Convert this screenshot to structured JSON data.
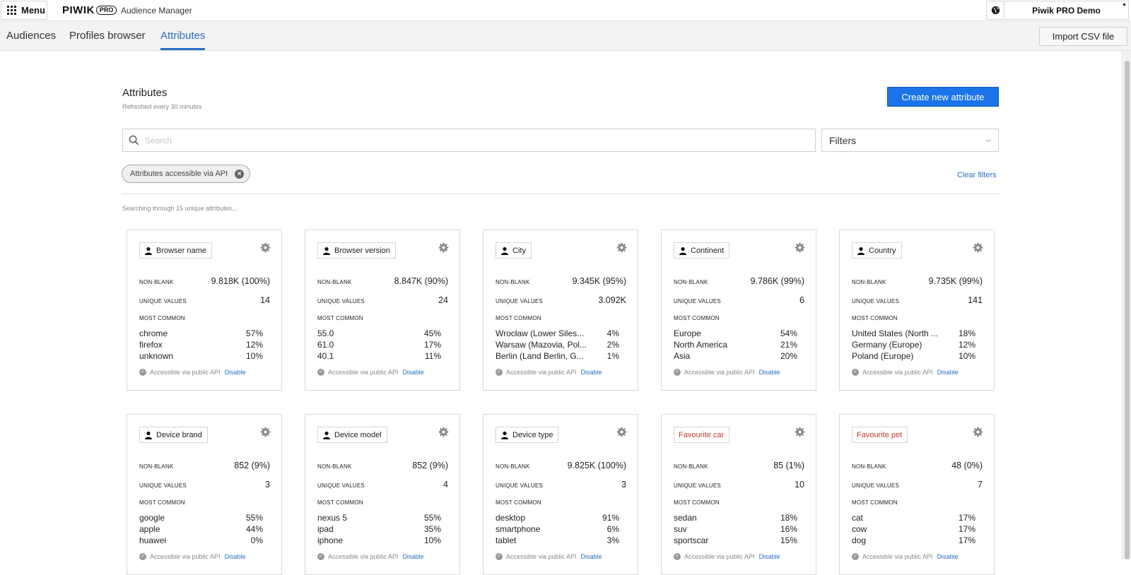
{
  "topbar": {
    "menu_label": "Menu",
    "logo_text": "PIWIK",
    "logo_badge": "PRO",
    "app_name": "Audience Manager",
    "account_name": "Piwik PRO Demo"
  },
  "nav": {
    "tabs": [
      {
        "label": "Audiences",
        "active": false
      },
      {
        "label": "Profiles browser",
        "active": false
      },
      {
        "label": "Attributes",
        "active": true
      }
    ],
    "import_label": "Import CSV file"
  },
  "header": {
    "title": "Attributes",
    "subtitle": "Refreshed every 30 minutes",
    "create_label": "Create new attribute"
  },
  "search": {
    "placeholder": "Search",
    "value": "",
    "filters_label": "Filters"
  },
  "active_filter": {
    "label": "Attributes accessible via API",
    "clear_label": "Clear filters"
  },
  "search_status": "Searching through 15 unique attributes...",
  "labels": {
    "non_blank": "NON-BLANK",
    "unique_values": "UNIQUE VALUES",
    "most_common": "MOST COMMON",
    "api_text": "Accessible via public API",
    "disable": "Disable"
  },
  "colors": {
    "accent": "#1a73e8",
    "link": "#2a6fc4",
    "custom_attribute": "#c0392b"
  },
  "cards": [
    {
      "name": "Browser name",
      "custom": false,
      "non_blank": "9.818K (100%)",
      "unique": "14",
      "common": [
        {
          "n": "chrome",
          "p": "57%"
        },
        {
          "n": "firefox",
          "p": "12%"
        },
        {
          "n": "unknown",
          "p": "10%"
        }
      ]
    },
    {
      "name": "Browser version",
      "custom": false,
      "non_blank": "8.847K (90%)",
      "unique": "24",
      "common": [
        {
          "n": "55.0",
          "p": "45%"
        },
        {
          "n": "61.0",
          "p": "17%"
        },
        {
          "n": "40.1",
          "p": "11%"
        }
      ]
    },
    {
      "name": "City",
      "custom": false,
      "non_blank": "9.345K (95%)",
      "unique": "3.092K",
      "common": [
        {
          "n": "Wrocław (Lower Siles...",
          "p": "4%"
        },
        {
          "n": "Warsaw (Mazovia, Pol...",
          "p": "2%"
        },
        {
          "n": "Berlin (Land Berlin, G...",
          "p": "1%"
        }
      ]
    },
    {
      "name": "Continent",
      "custom": false,
      "non_blank": "9.786K (99%)",
      "unique": "6",
      "common": [
        {
          "n": "Europe",
          "p": "54%"
        },
        {
          "n": "North America",
          "p": "21%"
        },
        {
          "n": "Asia",
          "p": "20%"
        }
      ]
    },
    {
      "name": "Country",
      "custom": false,
      "non_blank": "9.735K (99%)",
      "unique": "141",
      "common": [
        {
          "n": "United States (North ...",
          "p": "18%"
        },
        {
          "n": "Germany (Europe)",
          "p": "12%"
        },
        {
          "n": "Poland (Europe)",
          "p": "10%"
        }
      ]
    },
    {
      "name": "Device brand",
      "custom": false,
      "non_blank": "852 (9%)",
      "unique": "3",
      "common": [
        {
          "n": "google",
          "p": "55%"
        },
        {
          "n": "apple",
          "p": "44%"
        },
        {
          "n": "huawei",
          "p": "0%"
        }
      ]
    },
    {
      "name": "Device model",
      "custom": false,
      "non_blank": "852 (9%)",
      "unique": "4",
      "common": [
        {
          "n": "nexus 5",
          "p": "55%"
        },
        {
          "n": "ipad",
          "p": "35%"
        },
        {
          "n": "iphone",
          "p": "10%"
        }
      ]
    },
    {
      "name": "Device type",
      "custom": false,
      "non_blank": "9.825K (100%)",
      "unique": "3",
      "common": [
        {
          "n": "desktop",
          "p": "91%"
        },
        {
          "n": "smartphone",
          "p": "6%"
        },
        {
          "n": "tablet",
          "p": "3%"
        }
      ]
    },
    {
      "name": "Favourite car",
      "custom": true,
      "non_blank": "85 (1%)",
      "unique": "10",
      "common": [
        {
          "n": "sedan",
          "p": "18%"
        },
        {
          "n": "suv",
          "p": "16%"
        },
        {
          "n": "sportscar",
          "p": "15%"
        }
      ]
    },
    {
      "name": "Favourite pet",
      "custom": true,
      "non_blank": "48 (0%)",
      "unique": "7",
      "common": [
        {
          "n": "cat",
          "p": "17%"
        },
        {
          "n": "cow",
          "p": "17%"
        },
        {
          "n": "dog",
          "p": "17%"
        }
      ]
    }
  ]
}
